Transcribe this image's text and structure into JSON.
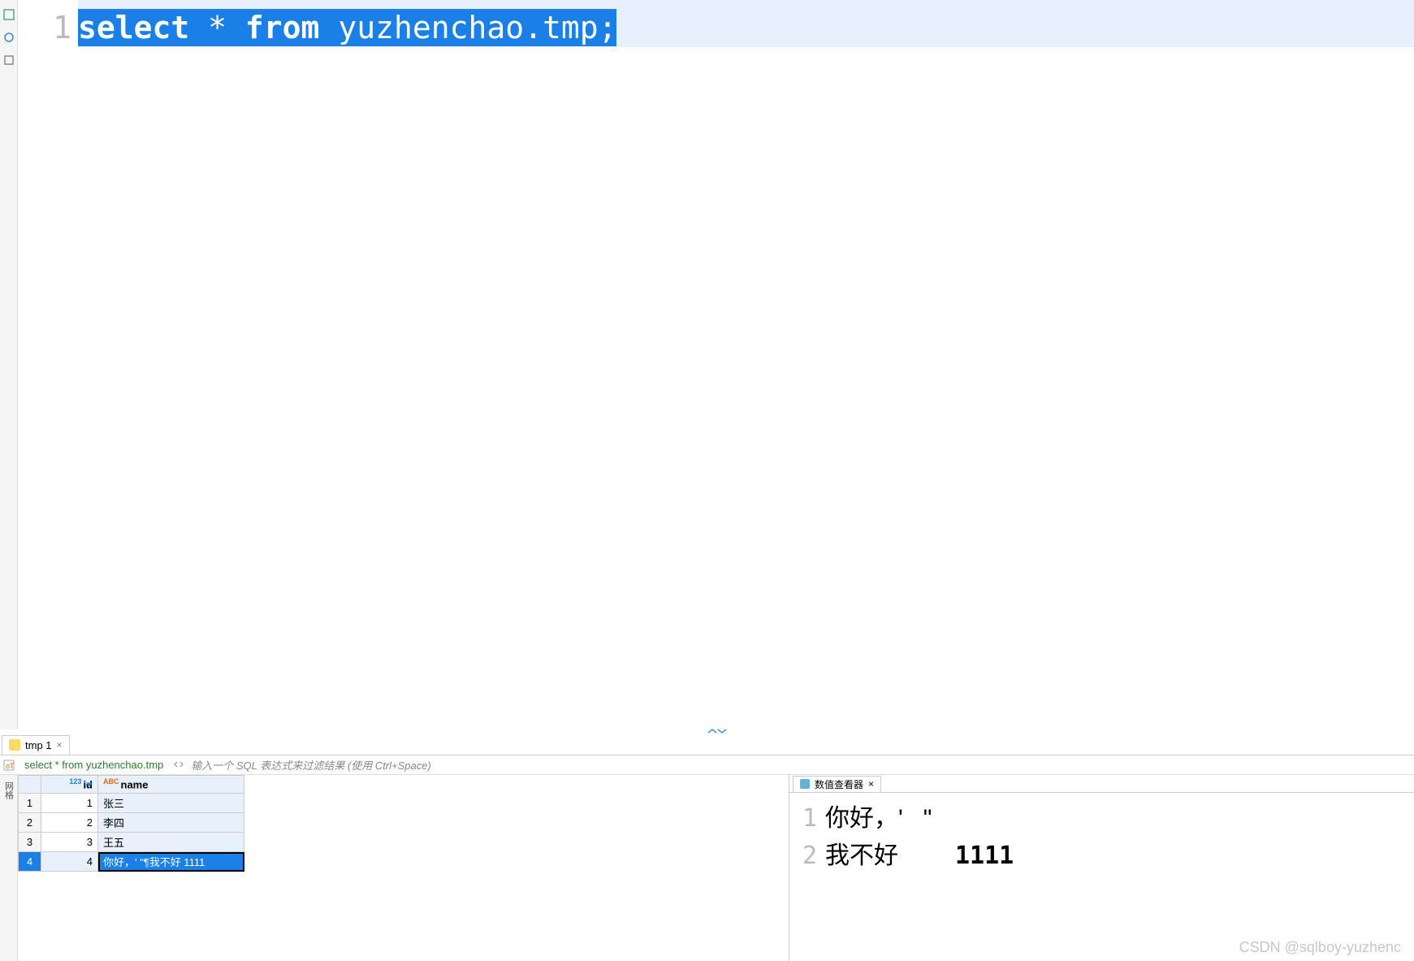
{
  "editor": {
    "line_number": "1",
    "code_kw1": "select",
    "code_star": " * ",
    "code_kw2": "from",
    "code_rest": " yuzhenchao.tmp;"
  },
  "result_tab": {
    "label": "tmp 1"
  },
  "filter": {
    "tabname": "select * from yuzhenchao.tmp",
    "placeholder": "输入一个 SQL 表达式来过滤结果 (使用 Ctrl+Space)"
  },
  "side_label": "网格",
  "columns": {
    "id": {
      "type": "123",
      "label": "id"
    },
    "name": {
      "type": "ABC",
      "label": "name"
    }
  },
  "rows": [
    {
      "n": "1",
      "id": "1",
      "name": "张三"
    },
    {
      "n": "2",
      "id": "2",
      "name": "李四"
    },
    {
      "n": "3",
      "id": "3",
      "name": "王五"
    },
    {
      "n": "4",
      "id": "4",
      "name": "你好，' \"¶我不好 1111"
    }
  ],
  "viewer": {
    "title": "数值查看器",
    "lines": [
      {
        "n": "1",
        "text": "你好，'   \""
      },
      {
        "n": "2",
        "text": "我不好",
        "num": "1111"
      }
    ]
  },
  "watermark": "CSDN @sqlboy-yuzhenc"
}
